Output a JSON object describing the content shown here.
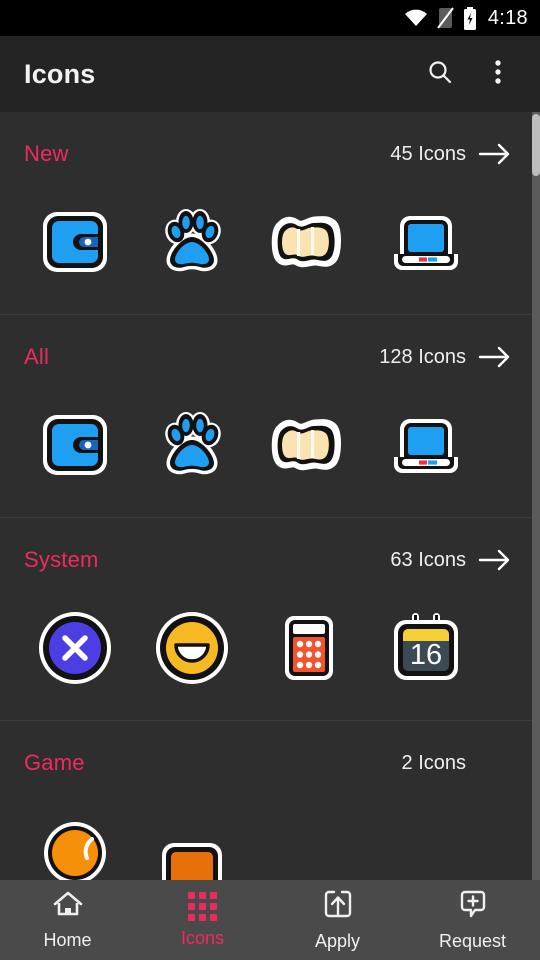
{
  "status_bar": {
    "time": "4:18",
    "icons": [
      "wifi-icon",
      "signal-off-icon",
      "battery-charging-icon"
    ]
  },
  "app_bar": {
    "title": "Icons",
    "search_icon": "search-icon",
    "overflow_icon": "more-vertical-icon"
  },
  "theme": {
    "accent": "#ef2a5f",
    "background": "#2e2e2e",
    "appbar_background": "#242424",
    "statusbar_background": "#000000",
    "bottomnav_background": "#4a4a4a",
    "text_primary": "#efefef",
    "divider": "#3b3b3b"
  },
  "sections": [
    {
      "title": "New",
      "count_label": "45 Icons",
      "count": 45,
      "has_arrow": true,
      "arrow_icon": "arrow-right-icon",
      "icons": [
        "wallet-icon",
        "paw-print-icon",
        "folded-map-icon",
        "laptop-icon"
      ]
    },
    {
      "title": "All",
      "count_label": "128 Icons",
      "count": 128,
      "has_arrow": true,
      "arrow_icon": "arrow-right-icon",
      "icons": [
        "wallet-icon",
        "paw-print-icon",
        "folded-map-icon",
        "laptop-icon"
      ]
    },
    {
      "title": "System",
      "count_label": "63 Icons",
      "count": 63,
      "has_arrow": true,
      "arrow_icon": "arrow-right-icon",
      "icons": [
        "close-circle-icon",
        "smiley-face-icon",
        "calculator-icon",
        "calendar-16-icon"
      ]
    },
    {
      "title": "Game",
      "count_label": "2 Icons",
      "count": 2,
      "has_arrow": false,
      "arrow_icon": "arrow-right-icon",
      "icons": [
        "orange-ball-icon",
        "orange-card-icon"
      ]
    }
  ],
  "icon_art": {
    "calendar_day": "16",
    "colors": {
      "blue": "#1e9ff2",
      "blue_dark": "#1565c0",
      "cream": "#fae3b0",
      "purple": "#4b3fe4",
      "amber": "#f7b924",
      "orange_red": "#f4522a",
      "slate": "#3c4a54",
      "yellow": "#f7d038",
      "orange": "#f79009",
      "red": "#e8324a",
      "outline": "#ffffff",
      "stroke": "#121212"
    }
  },
  "scrollbar": {
    "name": "vertical-scrollbar"
  },
  "bottom_nav": {
    "items": [
      {
        "label": "Home",
        "icon": "home-icon",
        "active": false
      },
      {
        "label": "Icons",
        "icon": "grid-icon",
        "active": true
      },
      {
        "label": "Apply",
        "icon": "apply-upload-icon",
        "active": false
      },
      {
        "label": "Request",
        "icon": "request-comment-plus-icon",
        "active": false
      }
    ]
  }
}
